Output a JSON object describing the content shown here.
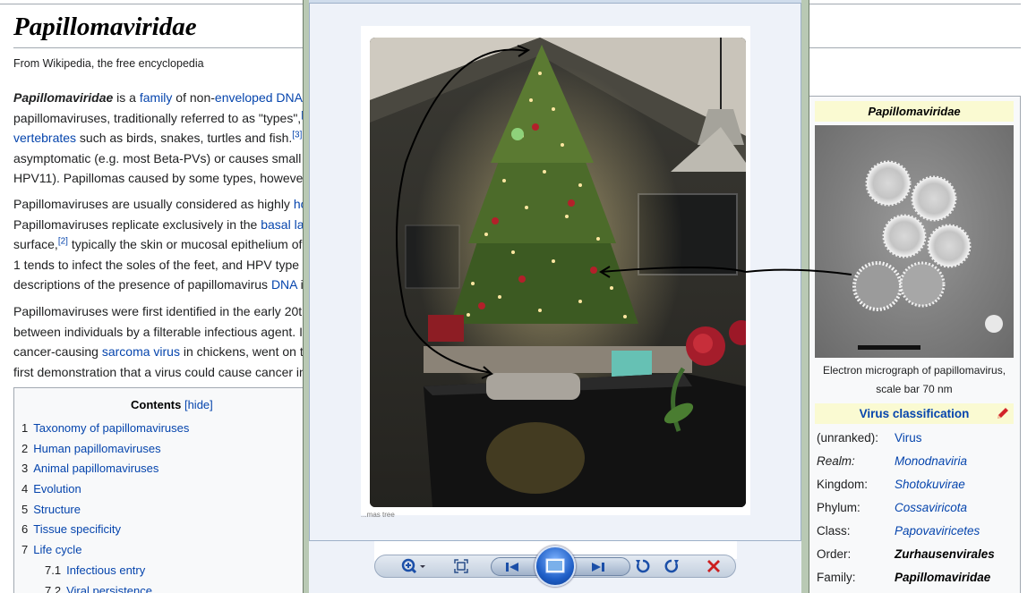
{
  "article": {
    "title": "Papillomaviridae",
    "tagline": "From Wikipedia, the free encyclopedia",
    "p1": {
      "l1a": "Papillomaviridae",
      "l1b": " is a ",
      "l1c": "family",
      "l1d": " of non-",
      "l1e": "enveloped DNA",
      "l2a": "papillomaviruses, traditionally referred to as \"types\",",
      "l2sup": "[",
      "l3a": "vertebrates",
      "l3b": " such as birds, snakes, turtles and fish.",
      "l3sup": "[3]",
      "l4": "asymptomatic (e.g. most Beta-PVs) or causes small",
      "l5": "HPV11). Papillomas caused by some types, howeve"
    },
    "p2": {
      "l1a": "Papillomaviruses are usually considered as highly ",
      "l1b": "ho",
      "l2a": "Papillomaviruses replicate exclusively in the ",
      "l2b": "basal la",
      "l3a": "surface,",
      "l3sup": "[2]",
      "l3b": " typically the skin or mucosal epithelium of",
      "l4": "1 tends to infect the soles of the feet, and HPV type",
      "l5a": "descriptions of the presence of papillomavirus ",
      "l5b": "DNA",
      "l5c": " i"
    },
    "p3": {
      "l1": "Papillomaviruses were first identified in the early 20th",
      "l2": "between individuals by a filterable infectious agent. I",
      "l3a": "cancer-causing ",
      "l3b": "sarcoma virus",
      "l3c": " in chickens, went on t",
      "l4": "first demonstration that a virus could cause cancer in"
    }
  },
  "toc": {
    "title": "Contents",
    "hide": "[hide]",
    "items": [
      {
        "num": "1",
        "label": "Taxonomy of papillomaviruses"
      },
      {
        "num": "2",
        "label": "Human papillomaviruses"
      },
      {
        "num": "3",
        "label": "Animal papillomaviruses"
      },
      {
        "num": "4",
        "label": "Evolution"
      },
      {
        "num": "5",
        "label": "Structure"
      },
      {
        "num": "6",
        "label": "Tissue specificity"
      },
      {
        "num": "7",
        "label": "Life cycle"
      },
      {
        "num": "7.1",
        "label": "Infectious entry"
      },
      {
        "num": "7.2",
        "label": "Viral persistence"
      }
    ]
  },
  "infobox": {
    "title": "Papillomaviridae",
    "caption_l1": "Electron micrograph of papillomavirus,",
    "caption_l2": "scale bar 70 nm",
    "section": "Virus classification",
    "rows": [
      {
        "k": "(unranked):",
        "v": "Virus"
      },
      {
        "k": "Realm:",
        "v": "Monodnaviria"
      },
      {
        "k": "Kingdom:",
        "v": "Shotokuvirae"
      },
      {
        "k": "Phylum:",
        "v": "Cossaviricota"
      },
      {
        "k": "Class:",
        "v": "Papovaviricetes"
      },
      {
        "k": "Order:",
        "v": "Zurhausenvirales"
      },
      {
        "k": "Family:",
        "v": "Papillomaviridae"
      }
    ]
  },
  "viewer": {
    "photo_caption": "...mas tree",
    "icons": {
      "zoom": "zoom-icon",
      "fit": "fit-to-window-icon",
      "prev": "previous-icon",
      "slideshow": "slideshow-icon",
      "next": "next-icon",
      "rotate_ccw": "rotate-counterclockwise-icon",
      "rotate_cw": "rotate-clockwise-icon",
      "delete": "delete-icon"
    }
  },
  "colors": {
    "link": "#0645ad",
    "infobox_header": "#fafad2",
    "viewer_bg": "#eef2f9",
    "delete": "#cc1f1f"
  }
}
